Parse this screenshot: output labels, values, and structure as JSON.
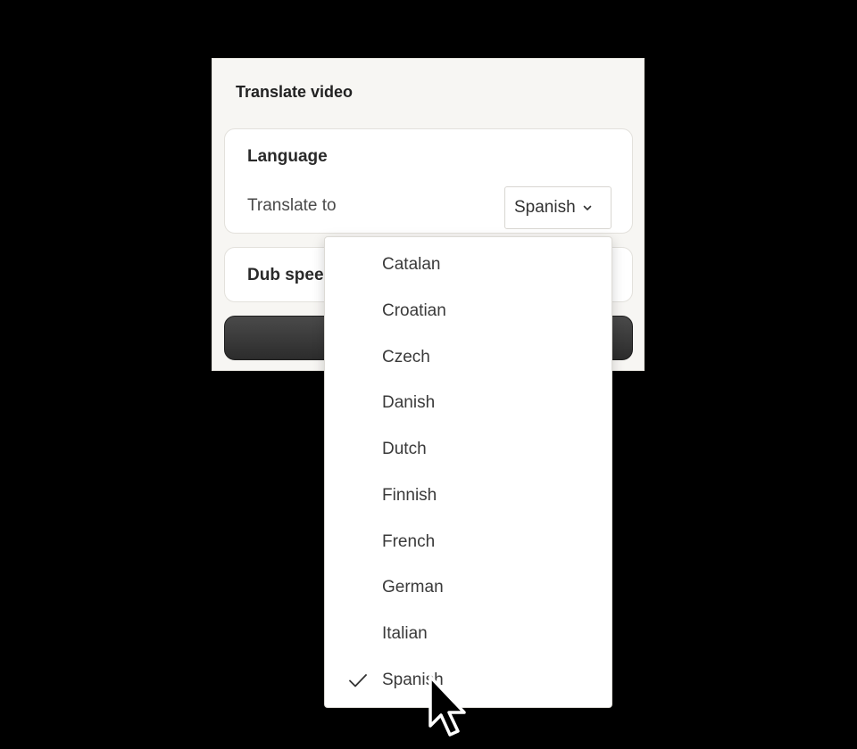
{
  "dialog": {
    "title": "Translate video"
  },
  "language_card": {
    "title": "Language",
    "translate_label": "Translate to",
    "selected_value": "Spanish"
  },
  "dub_card": {
    "title": "Dub spee"
  },
  "dropdown": {
    "options": [
      {
        "label": "Catalan",
        "selected": false
      },
      {
        "label": "Croatian",
        "selected": false
      },
      {
        "label": "Czech",
        "selected": false
      },
      {
        "label": "Danish",
        "selected": false
      },
      {
        "label": "Dutch",
        "selected": false
      },
      {
        "label": "Finnish",
        "selected": false
      },
      {
        "label": "French",
        "selected": false
      },
      {
        "label": "German",
        "selected": false
      },
      {
        "label": "Italian",
        "selected": false
      },
      {
        "label": "Spanish",
        "selected": true
      }
    ]
  },
  "icons": {
    "select_chevron": "chevron-down-icon",
    "selected_check": "check-icon",
    "pointer": "mouse-pointer-icon"
  },
  "colors": {
    "background": "#000000",
    "panel": "#f7f6f3",
    "card": "#ffffff",
    "cta": "#3a3a3a"
  }
}
